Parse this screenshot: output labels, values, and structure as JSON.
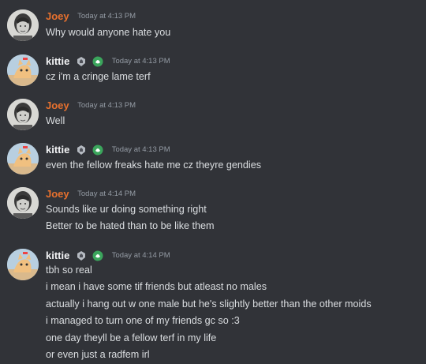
{
  "colors": {
    "background": "#313338",
    "joey_name": "#e8712e",
    "kittie_name": "#f2f3f5",
    "message_text": "#dbdee1",
    "timestamp": "#949ba4",
    "badge_green": "#3ba55c"
  },
  "messages": [
    {
      "author": "Joey",
      "timestamp": "Today at 4:13 PM",
      "lines": [
        "Why would anyone hate you"
      ]
    },
    {
      "author": "kittie",
      "timestamp": "Today at 4:13 PM",
      "badges": [
        "guild-tag-icon",
        "leaf-badge-icon"
      ],
      "lines": [
        "cz i'm a cringe lame terf"
      ]
    },
    {
      "author": "Joey",
      "timestamp": "Today at 4:13 PM",
      "lines": [
        "Well"
      ]
    },
    {
      "author": "kittie",
      "timestamp": "Today at 4:13 PM",
      "badges": [
        "guild-tag-icon",
        "leaf-badge-icon"
      ],
      "lines": [
        "even the fellow freaks hate me cz theyre gendies"
      ]
    },
    {
      "author": "Joey",
      "timestamp": "Today at 4:14 PM",
      "lines": [
        "Sounds like ur doing something right",
        "Better to be hated than to be like them"
      ]
    },
    {
      "author": "kittie",
      "timestamp": "Today at 4:14 PM",
      "badges": [
        "guild-tag-icon",
        "leaf-badge-icon"
      ],
      "lines": [
        "tbh so real",
        "i mean i have some tif friends but atleast no males",
        "actually i hang out w one male but he's slightly better than the other moids",
        "i managed to turn one of my friends gc so :3",
        "one day theyll be a fellow terf in my life",
        "or even just a radfem irl"
      ]
    }
  ]
}
